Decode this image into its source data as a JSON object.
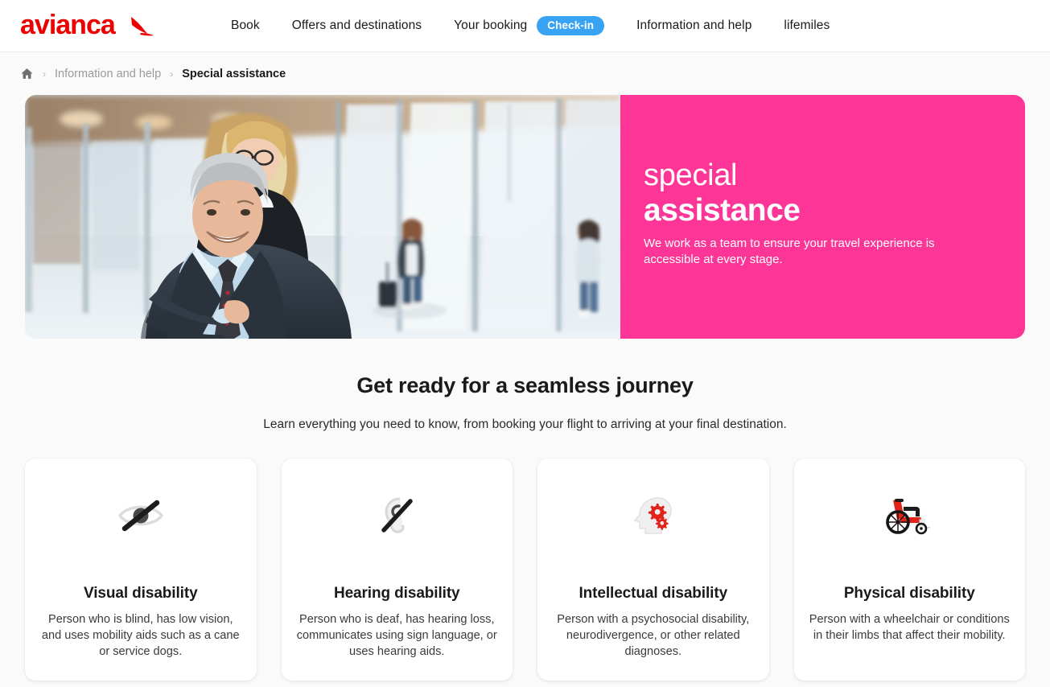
{
  "header": {
    "logo_text": "avianca",
    "logo_icon": "avianca-condor-icon",
    "nav": [
      {
        "label": "Book",
        "name": "nav-book"
      },
      {
        "label": "Offers and destinations",
        "name": "nav-offers-and-destinations"
      },
      {
        "label": "Your booking",
        "name": "nav-your-booking"
      },
      {
        "label": "Information and help",
        "name": "nav-information-and-help"
      },
      {
        "label": "lifemiles",
        "name": "nav-lifemiles"
      }
    ],
    "checkin_badge": "Check-in",
    "accent_blue": "#38a3f2",
    "brand_red": "#ed0000"
  },
  "breadcrumb": {
    "home_icon": "home-icon",
    "separator": "›",
    "items": [
      {
        "label": "Information and help",
        "current": false
      },
      {
        "label": "Special assistance",
        "current": true
      }
    ]
  },
  "hero": {
    "photo_alt": "Smiling man in a suit seated in a wheelchair assisted by an airline agent in an airport corridor",
    "title_line1": "special",
    "title_line2": "assistance",
    "subtitle": "We work as a team to ensure your travel experience is accessible at every stage.",
    "panel_color": "#fc3596"
  },
  "section": {
    "title": "Get ready for a seamless journey",
    "subtitle": "Learn everything you need to know, from booking your flight to arriving at your final destination."
  },
  "cards": [
    {
      "icon": "eye-off-icon",
      "title": "Visual disability",
      "text": "Person who is blind, has low vision, and uses mobility aids such as a cane or service dogs."
    },
    {
      "icon": "ear-off-icon",
      "title": "Hearing disability",
      "text": "Person who is deaf, has hearing loss, communicates using sign language, or uses hearing aids."
    },
    {
      "icon": "head-gears-icon",
      "title": "Intellectual disability",
      "text": "Person with a psychosocial disability, neurodivergence, or other related diagnoses."
    },
    {
      "icon": "wheelchair-icon",
      "title": "Physical disability",
      "text": "Person with a wheelchair or conditions in their limbs that affect their mobility."
    }
  ]
}
